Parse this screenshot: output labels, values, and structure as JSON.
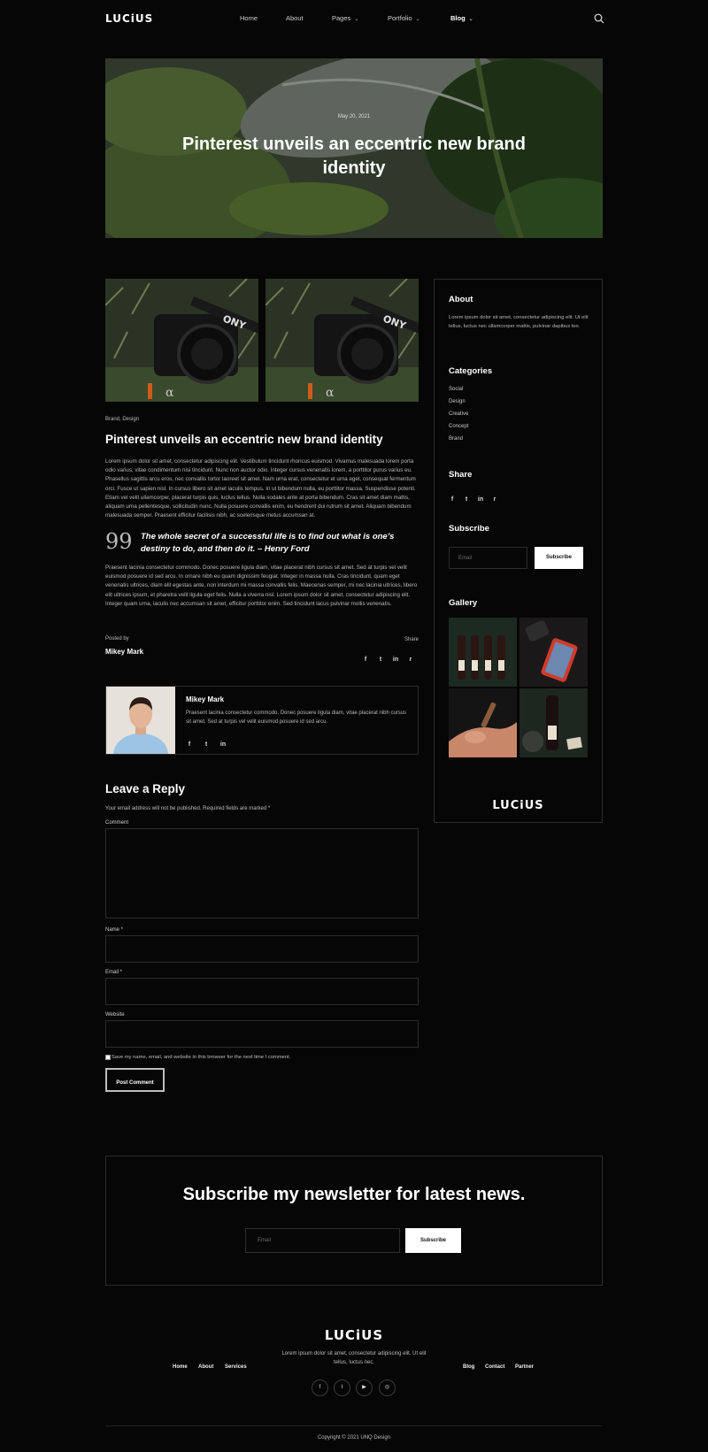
{
  "header": {
    "logo": "LUCiUS",
    "nav": [
      {
        "label": "Home",
        "has_dropdown": false
      },
      {
        "label": "About",
        "has_dropdown": false
      },
      {
        "label": "Pages",
        "has_dropdown": true
      },
      {
        "label": "Portfolio",
        "has_dropdown": true
      },
      {
        "label": "Blog",
        "has_dropdown": true,
        "active": true
      }
    ],
    "search_icon": "search-icon",
    "chevron": "⌄"
  },
  "hero": {
    "date": "May 20, 2021",
    "title": "Pinterest unveils an eccentric new brand identity"
  },
  "post": {
    "tags": "Brand, Design",
    "title": "Pinterest unveils an eccentric new brand identity",
    "body1": "Lorem ipsum dolor sit amet, consectetur adipiscing elit. Vestibulum tincidunt rhoncus euismod. Vivamus malesuada lorem porta odio varius, vitae condimentum nisi tincidunt. Nunc non auctor odio. Integer cursus venenatis lorem, a porttitor purus varius eu. Phasellus sagittis arcu eros, nec convallis tortor laoreet sit amet. Nam urna erat, consectetur et urna eget, consequat fermentum orci. Fusce ut sapien nisl. In cursus libero sit amet iaculis tempus. In ut bibendum nulla, eu porttitor massa. Suspendisse potenti. Etiam vel velit ullamcorper, placerat turpis quis, luctus tellus. Nulla sodales ante at porta bibendum. Cras sit amet diam mattis, aliquam urna pellentesque, sollicitudin nunc. Nulla posuere convallis enim, eu hendrerit dui rutrum sit amet. Aliquam bibendum malesuada semper. Praesent efficitur facilisis nibh, ac scelerisque metus accumsan at.",
    "quote_mark": "99",
    "quote": "The whole secret of a successful life is to find out what is one’s destiny to do, and then do it. – Henry Ford",
    "body2": "Praesent lacinia consectetur commodo. Donec posuere ligula diam, vitae placerat nibh cursus sit amet. Sed at turpis vel velit euismod posuere id sed arcu. In ornare nibh eu quam dignissim feugiat. Integer in massa nulla. Cras tincidunt, quam eget venenatis ultrices, diam elit egestas ante, non interdum mi massa convallis felis. Maecenas semper, mi nec lacinia ultrices, libero elit ultrices ipsum, et pharetra velit ligula eget felis. Nulla a viverra nisl. Lorem ipsum dolor sit amet, consectetur adipiscing elit. Integer quam urna, iaculis nec accumsan sit amet, efficitur porttitor enim. Sed tincidunt lacus pulvinar mollis venenatis.",
    "posted_by_label": "Posted by",
    "author": "Mikey Mark",
    "share_label": "Share",
    "share_icons": [
      "f",
      "t",
      "in",
      "r"
    ]
  },
  "author_box": {
    "name": "Mikey Mark",
    "bio": "Praesent lacinia consectetur commodo. Donec posuere ligula diam, vitae placerat nibh cursus sit amet. Sed at turpis vel velit euismod posuere id sed arcu.",
    "icons": [
      "f",
      "t",
      "in"
    ]
  },
  "reply": {
    "title": "Leave a Reply",
    "note": "Your email address will not be published. Required fields are marked *",
    "comment_label": "Comment",
    "name_label": "Name *",
    "email_label": "Email *",
    "website_label": "Website",
    "save_label": "Save my name, email, and website in this browser for the next time I comment.",
    "submit_label": "Post Comment"
  },
  "sidebar": {
    "about_title": "About",
    "about_text": "Lorem ipsum dolor sit amet, consectetur adipiscing elit. Ut elit tellus, luctus nec ullamcorper mattis, pulvinar dapibus leo.",
    "categories_title": "Categories",
    "categories": [
      "Social",
      "Design",
      "Creative",
      "Concept",
      "Brand"
    ],
    "share_title": "Share",
    "share_icons": [
      "f",
      "t",
      "in",
      "r"
    ],
    "subscribe_title": "Subscribe",
    "email_placeholder": "Email",
    "subscribe_button": "Subscribe",
    "gallery_title": "Gallery",
    "logo": "LUCiUS"
  },
  "newsletter": {
    "title": "Subscribe my newsletter for latest news.",
    "email_placeholder": "Email",
    "button": "Subscribe"
  },
  "footer": {
    "logo": "LUCiUS",
    "text": "Lorem ipsum dolor sit amet, consectetur adipiscing elit. Ut elit tellus, luctus nec.",
    "links_left": [
      "Home",
      "About",
      "Services"
    ],
    "links_right": [
      "Blog",
      "Contact",
      "Partner"
    ],
    "social": [
      "f",
      "t",
      "▶",
      "◎"
    ],
    "copyright": "Copyright © 2021 UNQ Design"
  }
}
